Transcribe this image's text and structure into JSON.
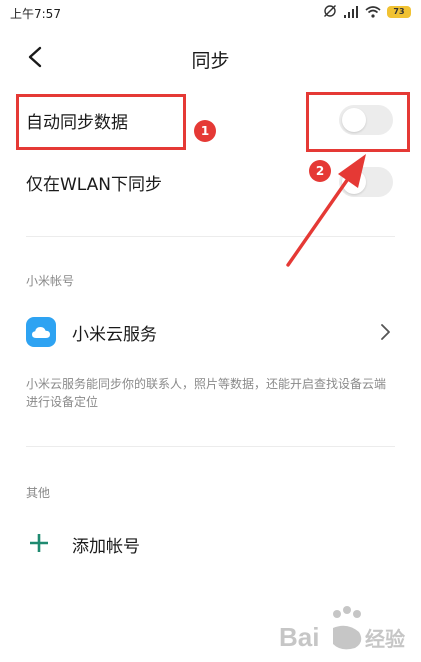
{
  "status_bar": {
    "time": "上午7:57",
    "battery": "73"
  },
  "header": {
    "title": "同步"
  },
  "settings": {
    "auto_sync": {
      "label": "自动同步数据",
      "enabled": false
    },
    "wlan_sync": {
      "label": "仅在WLAN下同步",
      "enabled": false
    }
  },
  "account_section": {
    "header": "小米帐号",
    "service": {
      "label": "小米云服务",
      "icon": "cloud-icon"
    },
    "description": "小米云服务能同步你的联系人，照片等数据，还能开启查找设备云端进行设备定位"
  },
  "other_section": {
    "header": "其他",
    "add_account": {
      "label": "添加帐号",
      "icon": "plus-icon"
    }
  },
  "annotations": {
    "badge_1": "1",
    "badge_2": "2",
    "color": "#e53935"
  },
  "colors": {
    "accent_green": "#1f8a70",
    "cloud_blue": "#2ea3f2",
    "toggle_off": "#ececec"
  }
}
